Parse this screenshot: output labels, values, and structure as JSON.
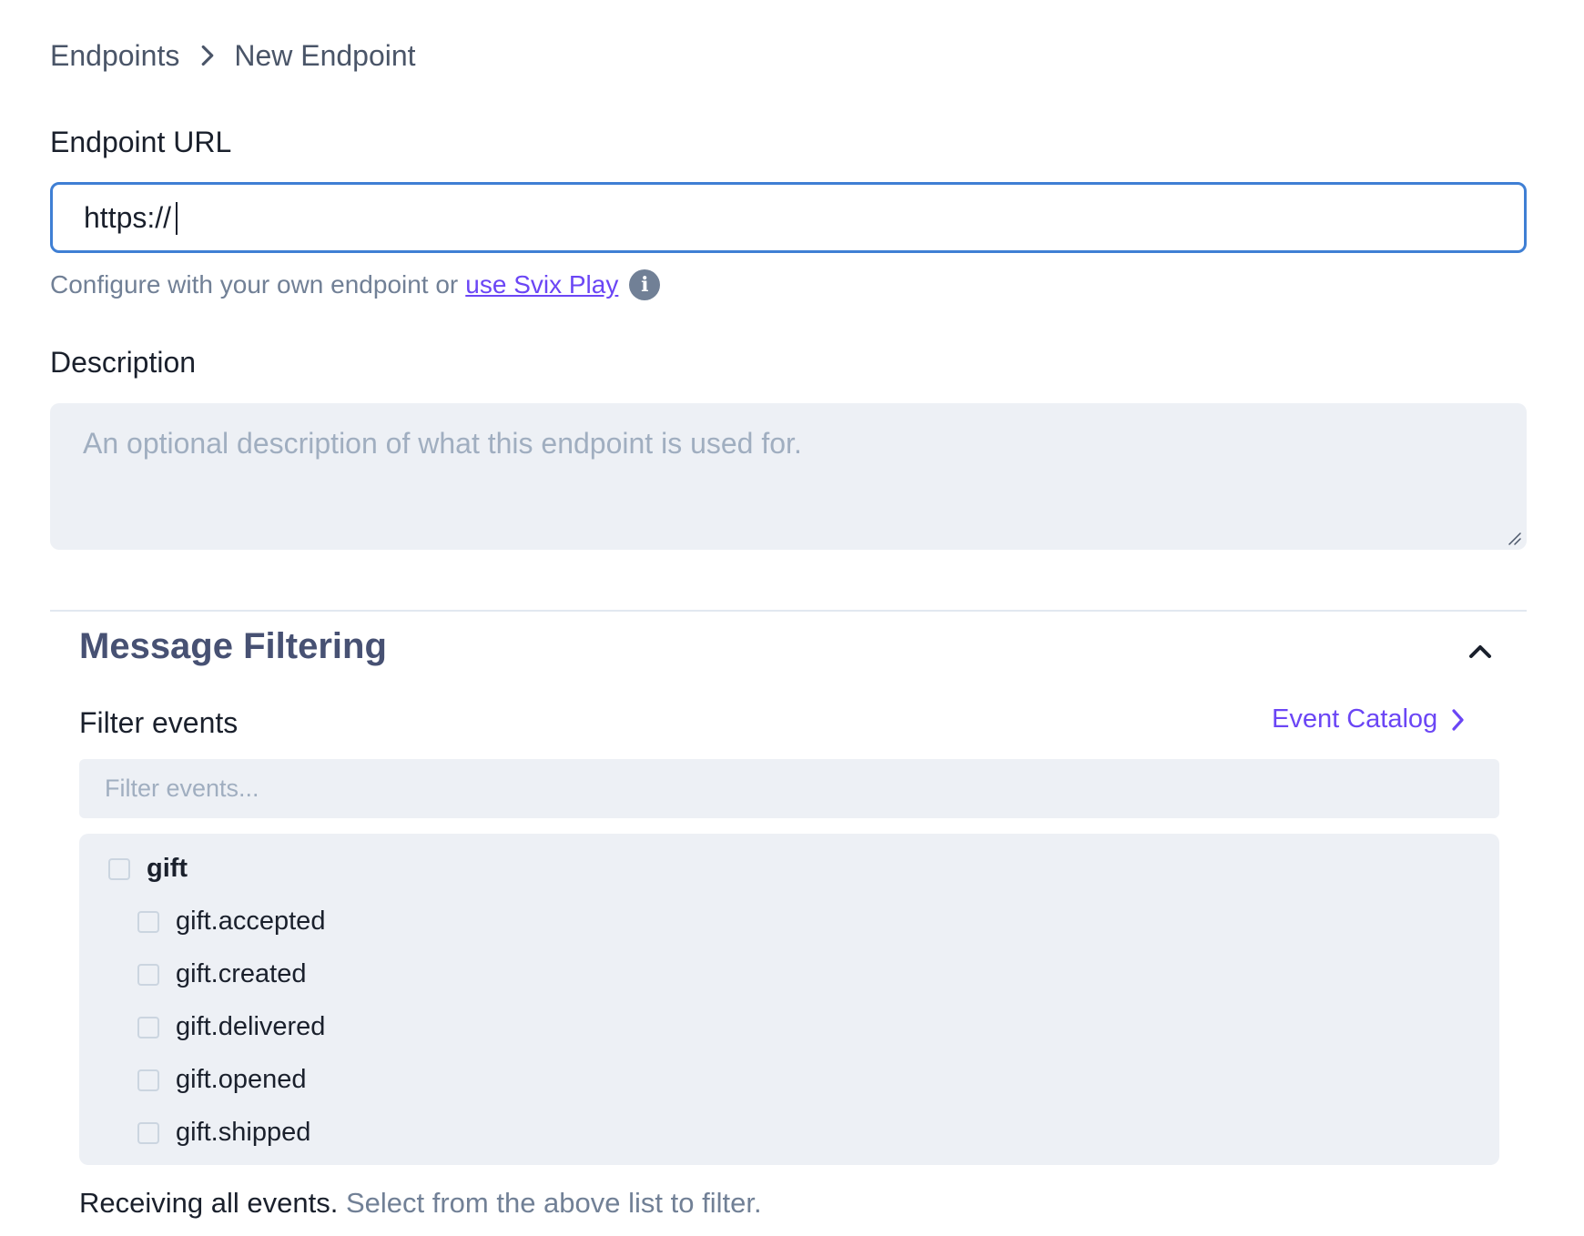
{
  "breadcrumb": {
    "parent": "Endpoints",
    "current": "New Endpoint"
  },
  "endpoint_url": {
    "label": "Endpoint URL",
    "value": "https://",
    "helper_prefix": "Configure with your own endpoint or",
    "helper_link": "use Svix Play"
  },
  "description": {
    "label": "Description",
    "placeholder": "An optional description of what this endpoint is used for."
  },
  "message_filtering": {
    "title": "Message Filtering",
    "filter_label": "Filter events",
    "catalog_link": "Event Catalog",
    "filter_placeholder": "Filter events...",
    "groups": [
      {
        "name": "gift",
        "checked": false,
        "events": [
          {
            "name": "gift.accepted",
            "checked": false
          },
          {
            "name": "gift.created",
            "checked": false
          },
          {
            "name": "gift.delivered",
            "checked": false
          },
          {
            "name": "gift.opened",
            "checked": false
          },
          {
            "name": "gift.shipped",
            "checked": false
          }
        ]
      }
    ],
    "summary_strong": "Receiving all events.",
    "summary_rest": "Select from the above list to filter."
  },
  "colors": {
    "accent": "#6b46f5",
    "focus_border": "#3f7fd4",
    "field_bg": "#edf0f5"
  }
}
